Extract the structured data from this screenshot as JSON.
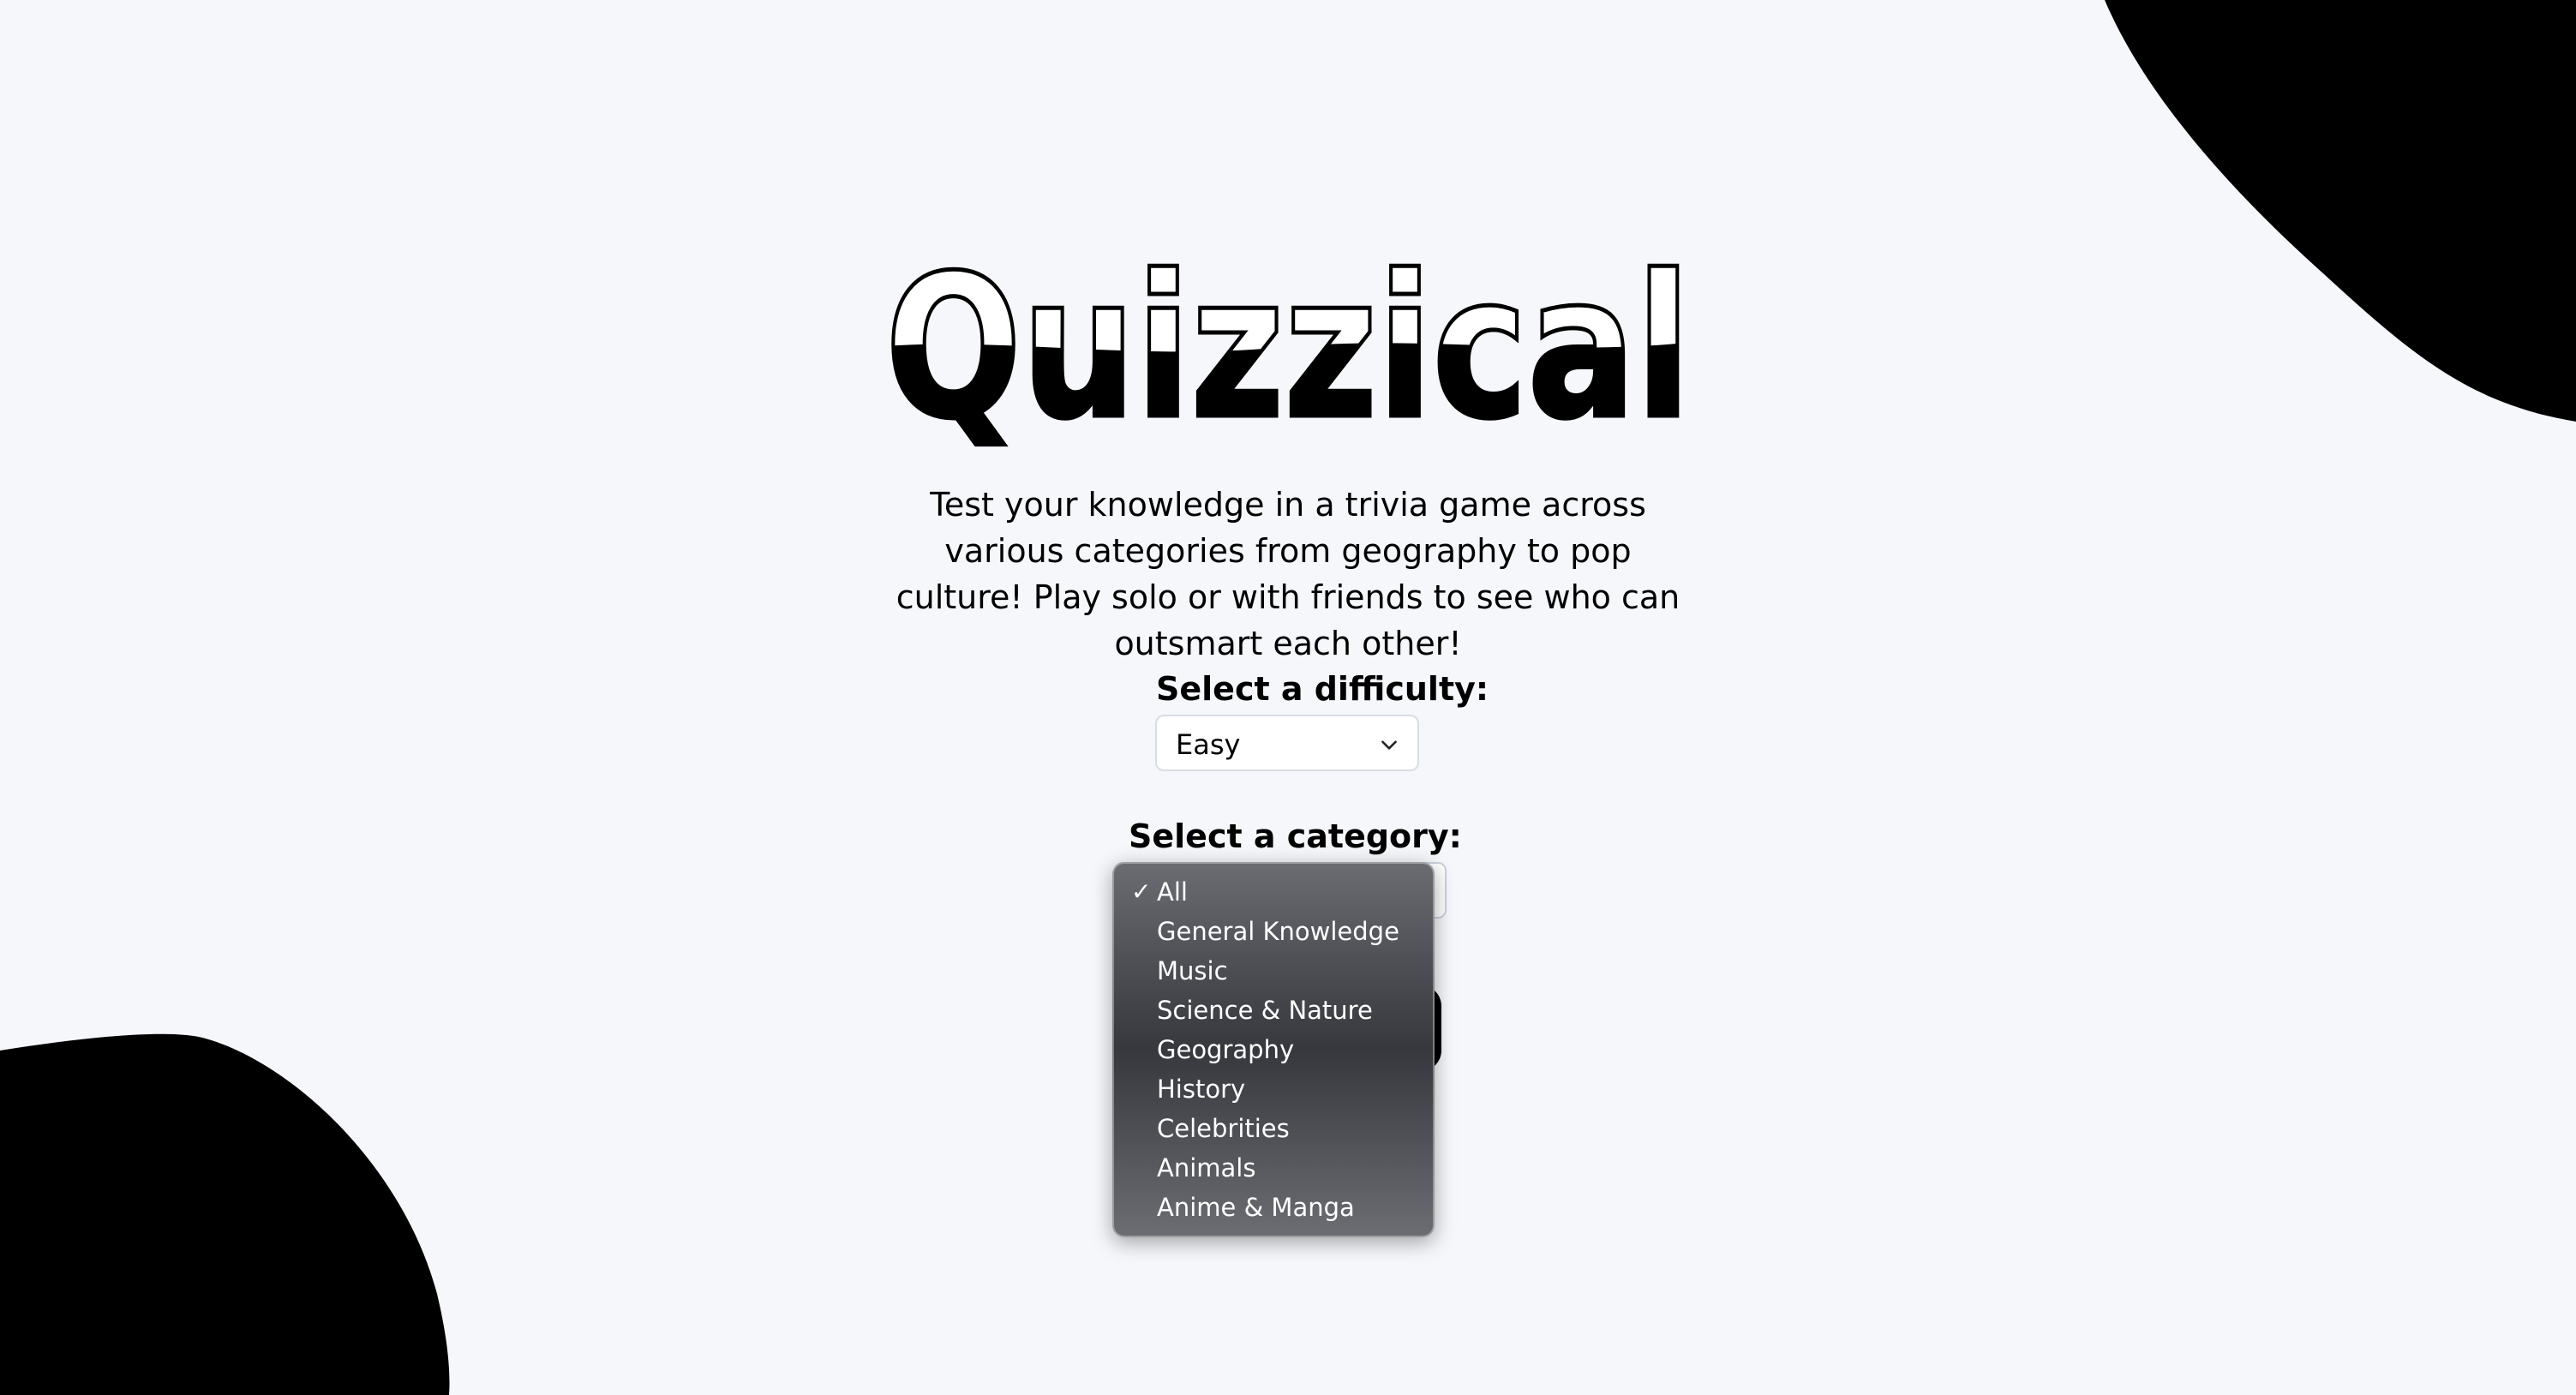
{
  "app": {
    "title": "Quizzical",
    "tagline": "Test your knowledge in a trivia game across various categories from geography to pop culture! Play solo or with friends to see who can outsmart each other!"
  },
  "difficulty": {
    "label": "Select a difficulty:",
    "selected": "Easy"
  },
  "category": {
    "label": "Select a category:",
    "selected": "All",
    "options": [
      "All",
      "General Knowledge",
      "Music",
      "Science & Nature",
      "Geography",
      "History",
      "Celebrities",
      "Animals",
      "Anime & Manga"
    ]
  },
  "colors": {
    "background": "#f5f7fb",
    "blob": "#000000",
    "dropdown": "#4a4c52",
    "text": "#000000"
  },
  "icons": {
    "select_arrow": "chevron-down-icon",
    "selected_option": "checkmark-icon"
  }
}
